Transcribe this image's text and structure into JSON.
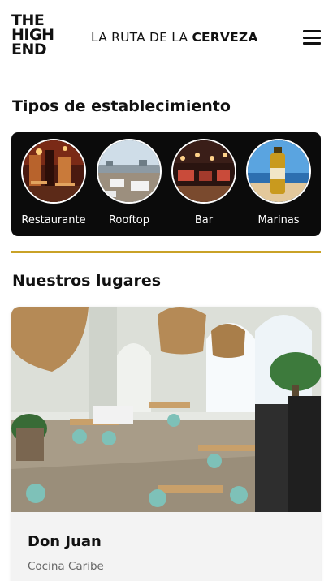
{
  "header": {
    "logo_lines": [
      "THE",
      "HIGH",
      "END"
    ],
    "title_prefix": "LA RUTA DE LA",
    "title_bold": "CERVEZA",
    "menu_icon": "hamburger-menu-icon"
  },
  "categories_section": {
    "title": "Tipos de establecimiento",
    "items": [
      {
        "label": "Restaurante"
      },
      {
        "label": "Rooftop"
      },
      {
        "label": "Bar"
      },
      {
        "label": "Marinas"
      }
    ]
  },
  "places_section": {
    "title": "Nuestros lugares",
    "cards": [
      {
        "name": "Don Juan",
        "subtitle": "Cocina Caribe"
      }
    ]
  },
  "colors": {
    "accent": "#c9a227",
    "panel": "#0b0b0b"
  }
}
